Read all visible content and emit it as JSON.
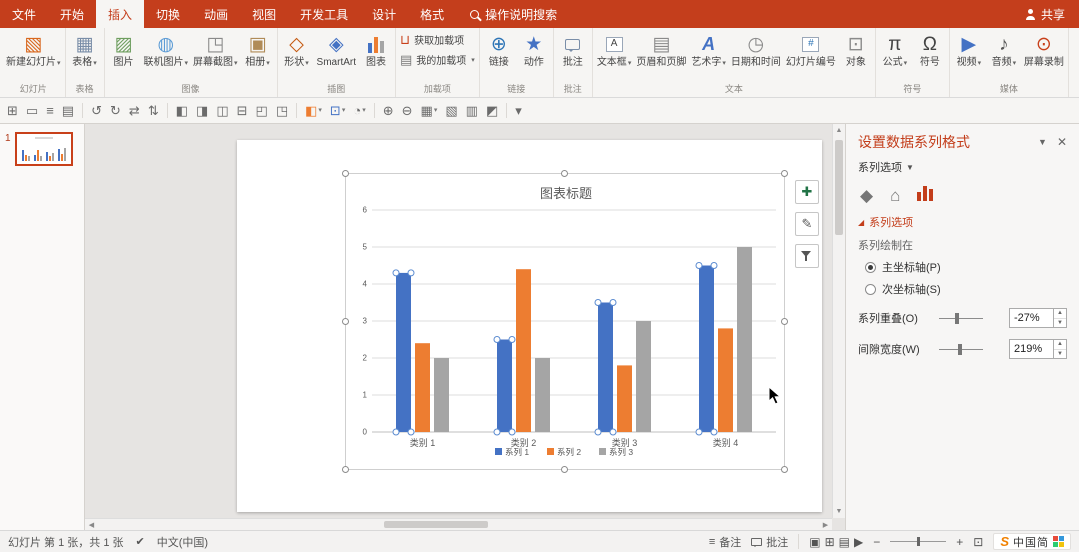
{
  "colors": {
    "accent": "#C43E1C",
    "series_blue": "#4472C4",
    "series_orange": "#ED7D31",
    "series_gray": "#A5A5A5"
  },
  "tabbar": {
    "tabs": [
      {
        "label": "文件",
        "file": true
      },
      {
        "label": "开始"
      },
      {
        "label": "插入",
        "active": true
      },
      {
        "label": "切换"
      },
      {
        "label": "动画"
      },
      {
        "label": "视图"
      },
      {
        "label": "开发工具"
      },
      {
        "label": "设计"
      },
      {
        "label": "格式"
      }
    ],
    "tell_me": "操作说明搜索",
    "share": "共享"
  },
  "ribbon": {
    "groups": [
      {
        "label": "幻灯片",
        "buttons": [
          {
            "label": "新建幻灯片",
            "icon": "new-slide",
            "arrow": true
          }
        ]
      },
      {
        "label": "表格",
        "buttons": [
          {
            "label": "表格",
            "icon": "table",
            "arrow": true
          }
        ]
      },
      {
        "label": "图像",
        "buttons": [
          {
            "label": "图片",
            "icon": "picture"
          },
          {
            "label": "联机图片",
            "icon": "online-pictures",
            "arrow": true
          },
          {
            "label": "屏幕截图",
            "icon": "screenshot",
            "arrow": true
          },
          {
            "label": "相册",
            "icon": "photo-album",
            "arrow": true
          }
        ]
      },
      {
        "label": "插图",
        "buttons": [
          {
            "label": "形状",
            "icon": "shapes",
            "arrow": true
          },
          {
            "label": "SmartArt",
            "icon": "smartart"
          },
          {
            "label": "图表",
            "icon": "chart"
          }
        ]
      },
      {
        "label": "加载项",
        "stacked": [
          {
            "label": "获取加载项",
            "icon": "store"
          },
          {
            "label": "我的加载项",
            "icon": "my-addins",
            "arrow": true
          }
        ]
      },
      {
        "label": "链接",
        "buttons": [
          {
            "label": "链接",
            "icon": "link"
          },
          {
            "label": "动作",
            "icon": "action"
          }
        ]
      },
      {
        "label": "批注",
        "buttons": [
          {
            "label": "批注",
            "icon": "comment"
          }
        ]
      },
      {
        "label": "文本",
        "buttons": [
          {
            "label": "文本框",
            "icon": "text-box",
            "arrow": true
          },
          {
            "label": "页眉和页脚",
            "icon": "header-footer"
          },
          {
            "label": "艺术字",
            "icon": "wordart",
            "arrow": true
          },
          {
            "label": "日期和时间",
            "icon": "date-time"
          },
          {
            "label": "幻灯片编号",
            "icon": "slide-number"
          },
          {
            "label": "对象",
            "icon": "object"
          }
        ]
      },
      {
        "label": "符号",
        "buttons": [
          {
            "label": "公式",
            "icon": "equation",
            "arrow": true
          },
          {
            "label": "符号",
            "icon": "symbol"
          }
        ]
      },
      {
        "label": "媒体",
        "buttons": [
          {
            "label": "视频",
            "icon": "video",
            "arrow": true
          },
          {
            "label": "音频",
            "icon": "audio",
            "arrow": true
          },
          {
            "label": "屏幕录制",
            "icon": "screen-recording"
          }
        ]
      }
    ]
  },
  "toolbar": {
    "items": [
      {
        "name": "insert-table",
        "glyph": "⊞"
      },
      {
        "name": "insert-shape",
        "glyph": "▭"
      },
      {
        "name": "align-text",
        "glyph": "≡"
      },
      {
        "name": "insert-placeholder",
        "glyph": "▤"
      },
      {
        "sep": true
      },
      {
        "name": "rotate-left",
        "glyph": "↺"
      },
      {
        "name": "rotate-right",
        "glyph": "↻"
      },
      {
        "name": "flip-horizontal",
        "glyph": "⇄"
      },
      {
        "name": "flip-vertical",
        "glyph": "⇅"
      },
      {
        "sep": true
      },
      {
        "name": "align-left",
        "glyph": "◧"
      },
      {
        "name": "align-right",
        "glyph": "◨"
      },
      {
        "name": "group",
        "glyph": "◫"
      },
      {
        "name": "ungroup",
        "glyph": "⊟"
      },
      {
        "name": "bring-to-front",
        "glyph": "◰"
      },
      {
        "name": "send-to-back",
        "glyph": "◳"
      },
      {
        "sep": true
      },
      {
        "name": "fill-color",
        "glyph": "◧",
        "color": "#ED7D31",
        "arrow": true
      },
      {
        "name": "outline-color",
        "glyph": "⊡",
        "color": "#4472C4",
        "arrow": true
      },
      {
        "name": "shape-effects",
        "glyph": "◔",
        "arrow": true
      },
      {
        "sep": true
      },
      {
        "name": "zoom-in",
        "glyph": "⊕"
      },
      {
        "name": "zoom-out",
        "glyph": "⊖"
      },
      {
        "name": "grid",
        "glyph": "▦",
        "arrow": true
      },
      {
        "name": "guides",
        "glyph": "▧"
      },
      {
        "name": "selection-pane",
        "glyph": "▥"
      },
      {
        "name": "crop",
        "glyph": "◩"
      },
      {
        "sep": true
      },
      {
        "name": "toolbar-options",
        "glyph": "▾"
      }
    ]
  },
  "thumbnails": {
    "slides": [
      {
        "number": "1"
      }
    ]
  },
  "chart_data": {
    "type": "bar",
    "title": "图表标题",
    "categories": [
      "类别 1",
      "类别 2",
      "类别 3",
      "类别 4"
    ],
    "series": [
      {
        "name": "系列 1",
        "color": "#4472C4",
        "values": [
          4.3,
          2.5,
          3.5,
          4.5
        ]
      },
      {
        "name": "系列 2",
        "color": "#ED7D31",
        "values": [
          2.4,
          4.4,
          1.8,
          2.8
        ]
      },
      {
        "name": "系列 3",
        "color": "#A5A5A5",
        "values": [
          2,
          2,
          3,
          5
        ]
      }
    ],
    "ylim": [
      0,
      6
    ],
    "ytick_step": 1,
    "grid": true,
    "legend_position": "bottom"
  },
  "chart_buttons": [
    {
      "name": "chart-elements",
      "glyph": "✚",
      "color": "#217346"
    },
    {
      "name": "chart-styles",
      "glyph": "✎",
      "color": "#555555"
    },
    {
      "name": "chart-filters",
      "glyph": "funnel"
    }
  ],
  "taskpane": {
    "title": "设置数据系列格式",
    "subtitle": "系列选项",
    "section": "系列选项",
    "plot_on_label": "系列绘制在",
    "primary_axis": "主坐标轴(P)",
    "secondary_axis": "次坐标轴(S)",
    "primary_selected": true,
    "overlap_label": "系列重叠(O)",
    "overlap_value": "-27%",
    "gap_label": "间隙宽度(W)",
    "gap_value": "219%"
  },
  "statusbar": {
    "slide_info": "幻灯片 第 1 张，共 1 张",
    "language": "中文(中国)",
    "notes": "备注",
    "comments": "批注",
    "view_icons": [
      {
        "name": "normal-view",
        "glyph": "▣"
      },
      {
        "name": "slide-sorter-view",
        "glyph": "⊞"
      },
      {
        "name": "reading-view",
        "glyph": "▤"
      },
      {
        "name": "slideshow-view",
        "glyph": "▶"
      }
    ],
    "zoom_minus": "−",
    "zoom_plus": "+",
    "fit_glyph": "⊡",
    "ime": {
      "logo": "S",
      "text": "中国简"
    }
  }
}
